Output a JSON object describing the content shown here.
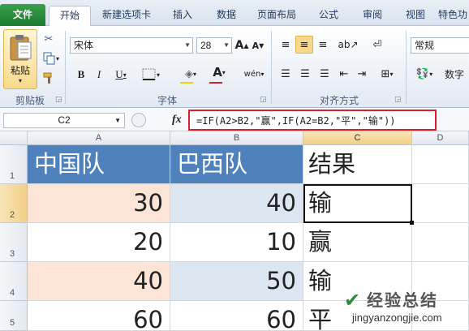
{
  "tabs": [
    "文件",
    "开始",
    "新建选项卡",
    "插入",
    "数据",
    "页面布局",
    "公式",
    "审阅",
    "视图",
    "特色功"
  ],
  "ribbon": {
    "paste_label": "粘贴",
    "font_name": "宋体",
    "font_size": "28",
    "grow_label": "A",
    "shrink_label": "A",
    "bold": "B",
    "italic": "I",
    "underline": "U",
    "font_color_letter": "A",
    "number_format": "常规",
    "number_btn": "数字",
    "groups": {
      "clipboard": "剪贴板",
      "font": "字体",
      "alignment": "对齐方式"
    }
  },
  "formula_bar": {
    "name_box": "C2",
    "fx": "fx",
    "formula": "=IF(A2>B2,\"赢\",IF(A2=B2,\"平\",\"输\"))"
  },
  "columns": [
    "A",
    "B",
    "C",
    "D"
  ],
  "rows": [
    "1",
    "2",
    "3",
    "4",
    "5"
  ],
  "table": {
    "headers": [
      "中国队",
      "巴西队",
      "结果"
    ],
    "rows": [
      [
        "30",
        "40",
        "输"
      ],
      [
        "20",
        "10",
        "赢"
      ],
      [
        "40",
        "50",
        "输"
      ],
      [
        "60",
        "60",
        "平"
      ]
    ]
  },
  "watermark": {
    "text": "经验总结",
    "url": "jingyanzongjie.com"
  },
  "colors": {
    "header_fill": "#4f81bd",
    "col_a_fill": "#fce4d6",
    "col_b_fill": "#dce6f1",
    "formula_highlight": "#d8202c",
    "file_tab": "#2e8b3e"
  }
}
